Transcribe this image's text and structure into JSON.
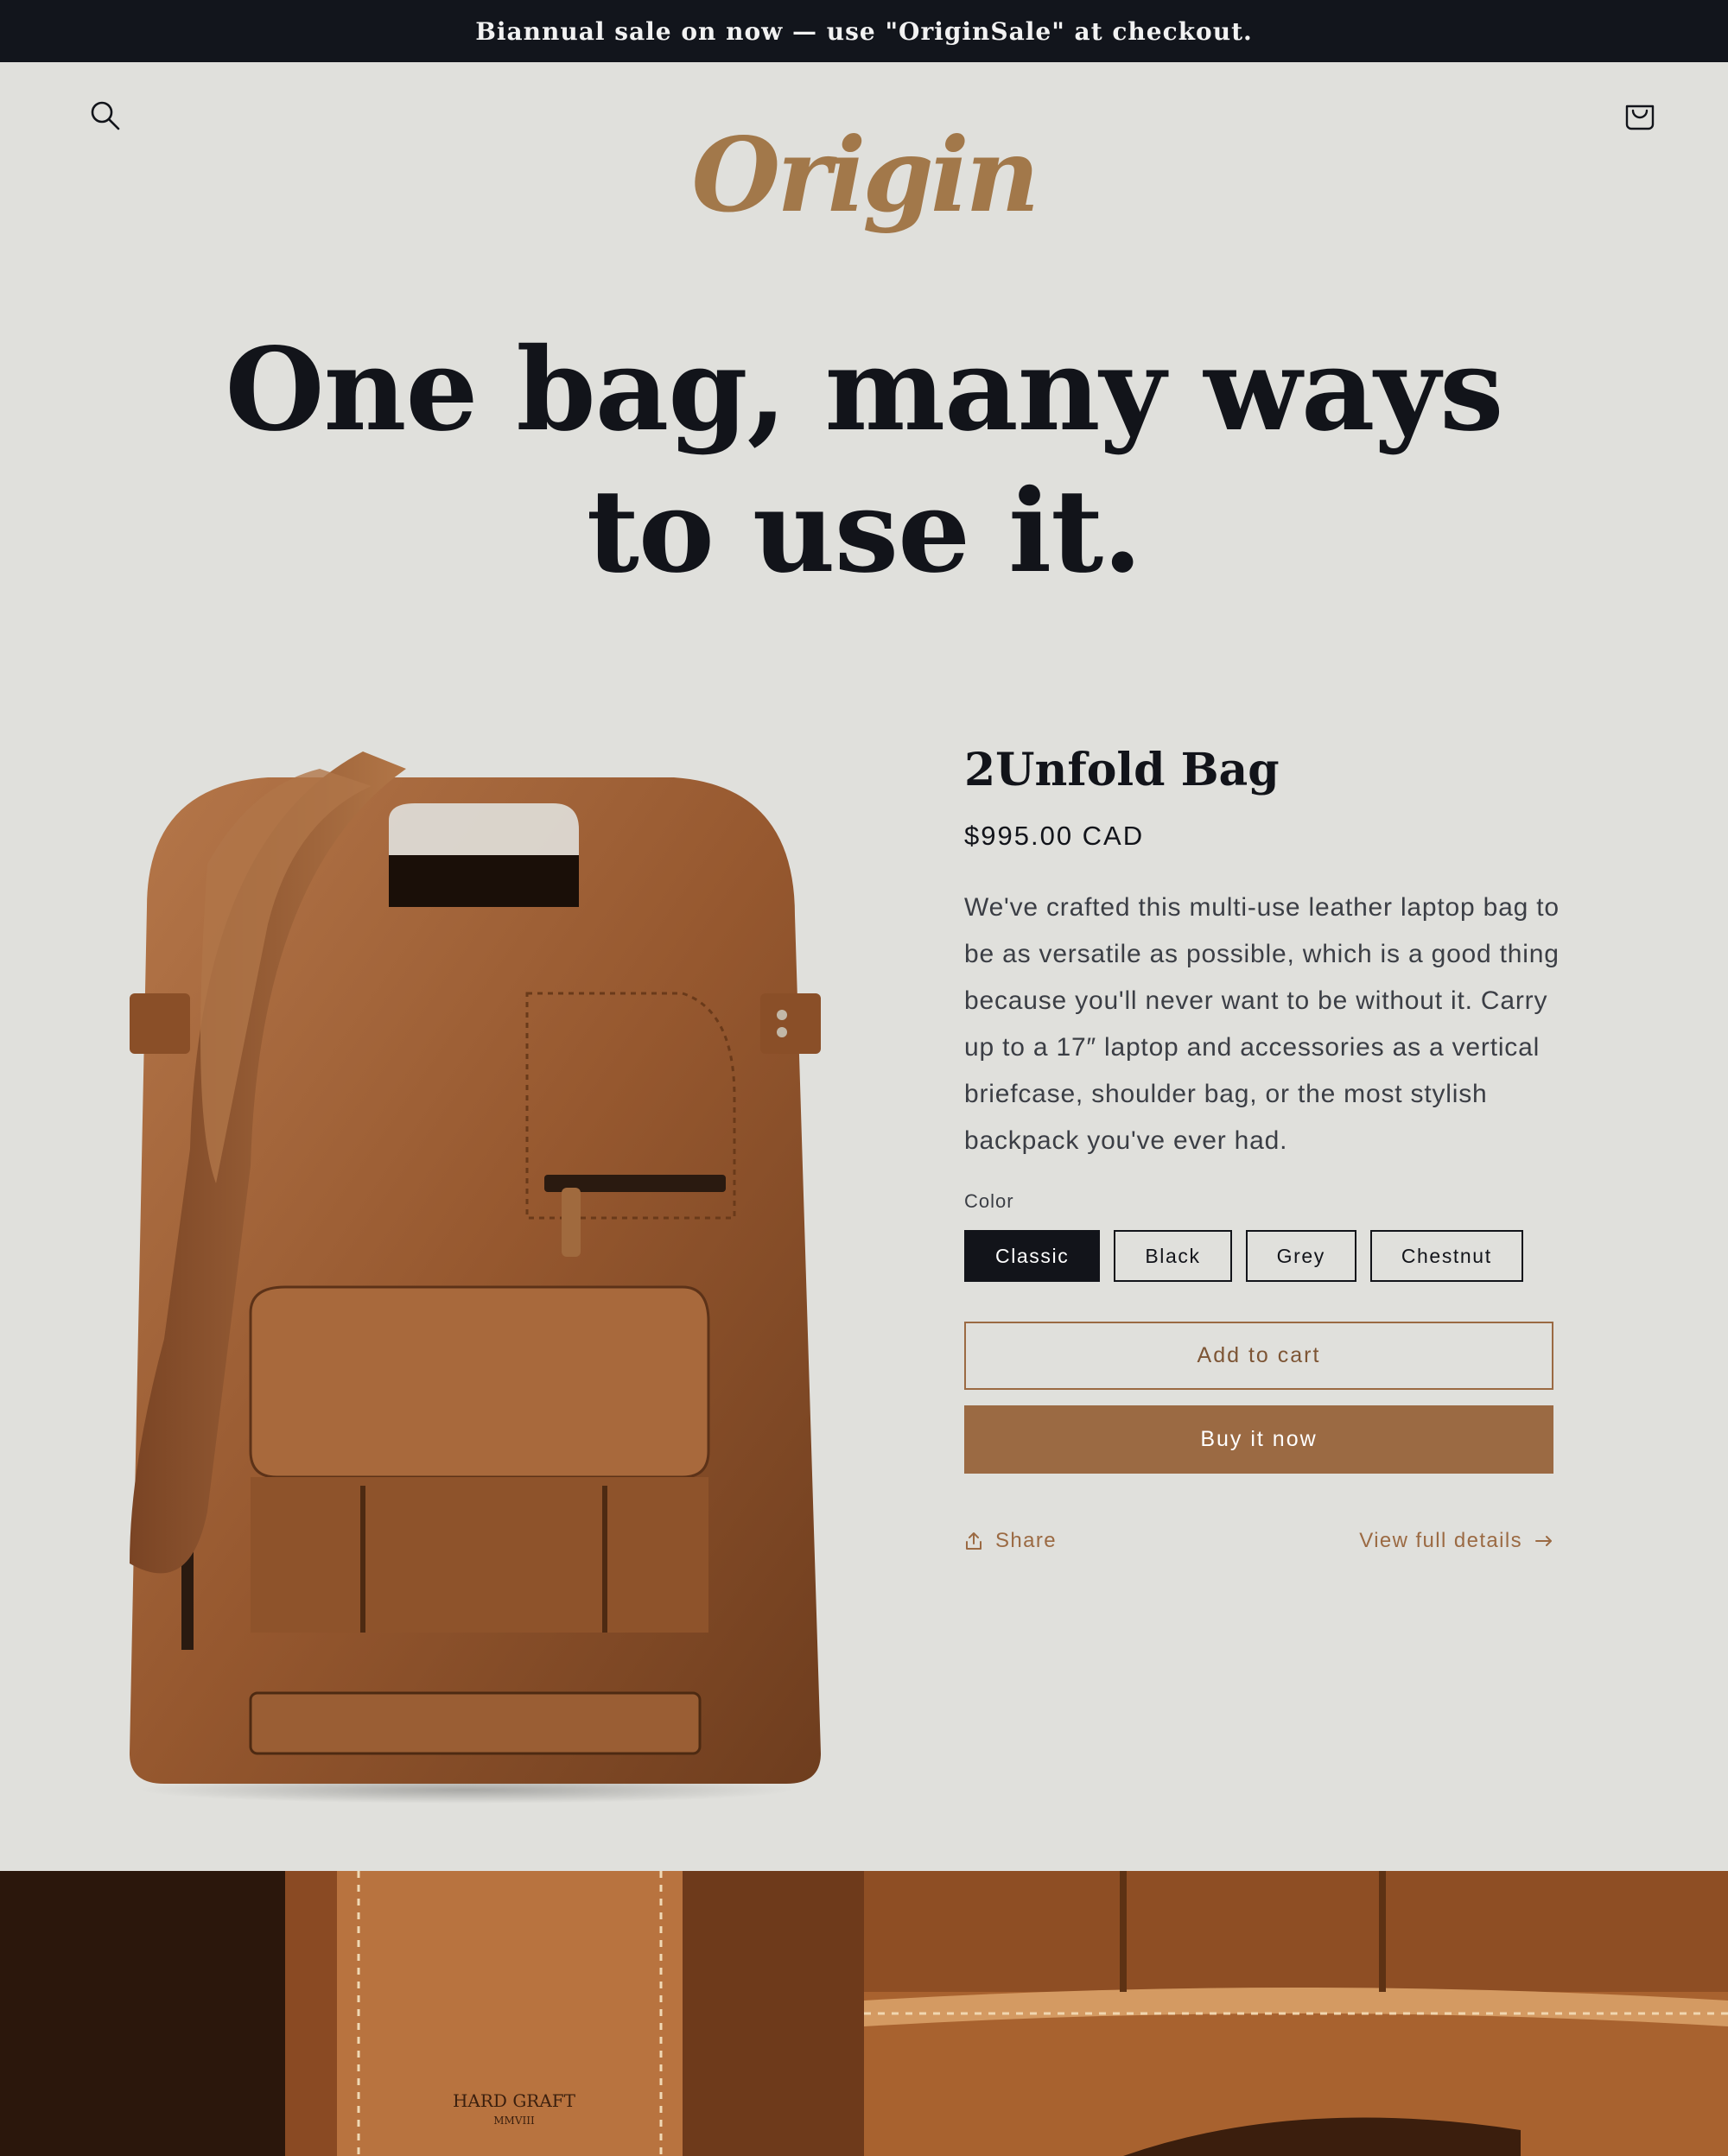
{
  "announcement": {
    "text": "Biannual sale on now — use \"OriginSale\" at checkout."
  },
  "header": {
    "logo_text": "Origin",
    "logo_color": "#a2784a",
    "search_icon": "search-icon",
    "cart_icon": "cart-icon"
  },
  "hero": {
    "line1": "One bag, many ways",
    "line2": "to use it."
  },
  "product": {
    "title": "2Unfold Bag",
    "price": "$995.00 CAD",
    "description": "We've crafted this multi-use leather laptop bag to be as versatile as possible, which is a good thing because you'll never want to be without it. Carry up to a 17″ laptop and accessories as a vertical briefcase, shoulder bag, or the most stylish backpack you've ever had.",
    "color_label": "Color",
    "colors": [
      "Classic",
      "Black",
      "Grey",
      "Chestnut"
    ],
    "selected_color": "Classic",
    "add_to_cart": "Add to cart",
    "buy_now": "Buy it now",
    "share_label": "Share",
    "share_icon": "share-icon",
    "details_label": "View full details",
    "details_icon": "arrow-right-icon"
  },
  "gallery": {
    "stamp_line1": "HARD GRAFT",
    "stamp_line2": "MMVIII"
  },
  "colors": {
    "background": "#e0e0dc",
    "announcement_bg": "#12151c",
    "accent": "#9b6a43",
    "text": "#12141a"
  }
}
